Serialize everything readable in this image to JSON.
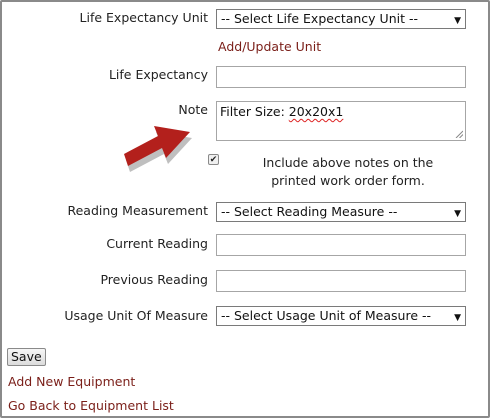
{
  "form": {
    "life_expectancy_unit": {
      "label": "Life Expectancy Unit",
      "selected": "-- Select Life Expectancy Unit --"
    },
    "add_update_unit_link": "Add/Update Unit",
    "life_expectancy": {
      "label": "Life Expectancy",
      "value": ""
    },
    "note": {
      "label": "Note",
      "value_prefix": "Filter Size: ",
      "value_misspelled": "20x20x1"
    },
    "include_notes": {
      "checked": true,
      "label_line1": "Include above notes on the",
      "label_line2": "printed work order form."
    },
    "reading_measurement": {
      "label": "Reading Measurement",
      "selected": "-- Select Reading Measure --"
    },
    "current_reading": {
      "label": "Current Reading",
      "value": ""
    },
    "previous_reading": {
      "label": "Previous Reading",
      "value": ""
    },
    "usage_unit": {
      "label": "Usage Unit Of Measure",
      "selected": "-- Select Usage Unit of Measure --"
    }
  },
  "actions": {
    "save_label": "Save",
    "add_new_equipment": "Add New Equipment",
    "go_back": "Go Back to Equipment List"
  },
  "colors": {
    "link": "#7a1e18",
    "callout_arrow": "#b3201c"
  },
  "icons": {
    "dropdown": "chevron-down-icon",
    "callout": "arrow-pointer-icon",
    "check": "checkmark-icon"
  }
}
